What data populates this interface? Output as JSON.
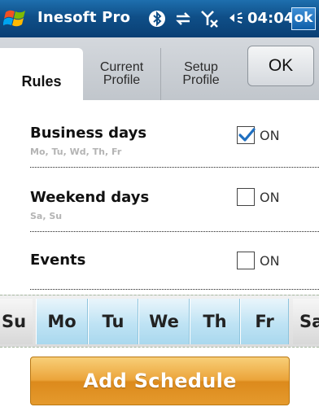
{
  "app": {
    "title": "Inesoft Pro",
    "time": "04:04",
    "ok_label": "ok",
    "status_icons": [
      "bluetooth-icon",
      "data-sync-icon",
      "no-signal-icon",
      "speaker-icon"
    ]
  },
  "tabs": [
    {
      "label": "Rules",
      "line1": "Rules",
      "line2": "",
      "active": true
    },
    {
      "label": "Current Profile",
      "line1": "Current",
      "line2": "Profile",
      "active": false
    },
    {
      "label": "Setup Profile",
      "line1": "Setup",
      "line2": "Profile",
      "active": false
    }
  ],
  "ok_button": {
    "label": "OK"
  },
  "rules": [
    {
      "title": "Business days",
      "subtitle": "Mo, Tu, Wd, Th, Fr",
      "checked": true,
      "state_label": "ON"
    },
    {
      "title": "Weekend days",
      "subtitle": "Sa, Su",
      "checked": false,
      "state_label": "ON"
    },
    {
      "title": "Events",
      "subtitle": "",
      "checked": false,
      "state_label": "ON"
    }
  ],
  "days": [
    {
      "label": "Su",
      "selected": false
    },
    {
      "label": "Mo",
      "selected": true
    },
    {
      "label": "Tu",
      "selected": true
    },
    {
      "label": "We",
      "selected": true
    },
    {
      "label": "Th",
      "selected": true
    },
    {
      "label": "Fr",
      "selected": true
    },
    {
      "label": "Sa",
      "selected": false
    }
  ],
  "add_button": {
    "label": "Add Schedule"
  },
  "colors": {
    "titlebar": "#0f4f88",
    "selected_day": "#bfe3f4",
    "add_button": "#eba43a",
    "checkmark": "#1f6fc0"
  }
}
